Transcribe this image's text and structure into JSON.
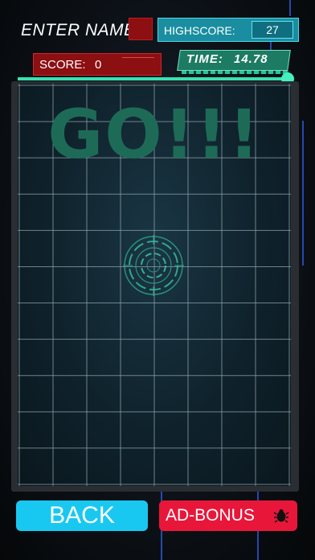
{
  "header": {
    "player_name": "ENTER NAME",
    "highscore_label": "HIGHSCORE:",
    "highscore_value": "27",
    "score_label": "SCORE:",
    "score_value": "0",
    "time_label": "TIME:",
    "time_value": "14.78"
  },
  "timer_progress": 1.0,
  "board": {
    "message": "GO!!!",
    "grid_columns": 8,
    "grid_rows": 11
  },
  "buttons": {
    "back_label": "BACK",
    "ad_bonus_label": "AD-BONUS"
  },
  "colors": {
    "back_button": "#19c8f0",
    "ad_button": "#e8173a",
    "go_text": "#1d6b57",
    "grid_line": "#8ea4ad",
    "accent_cyan": "#1a8ea0",
    "accent_red": "#8c0f12"
  },
  "icons": {
    "ad_bonus_icon": "bug-icon",
    "target": "target-reticle-icon"
  }
}
